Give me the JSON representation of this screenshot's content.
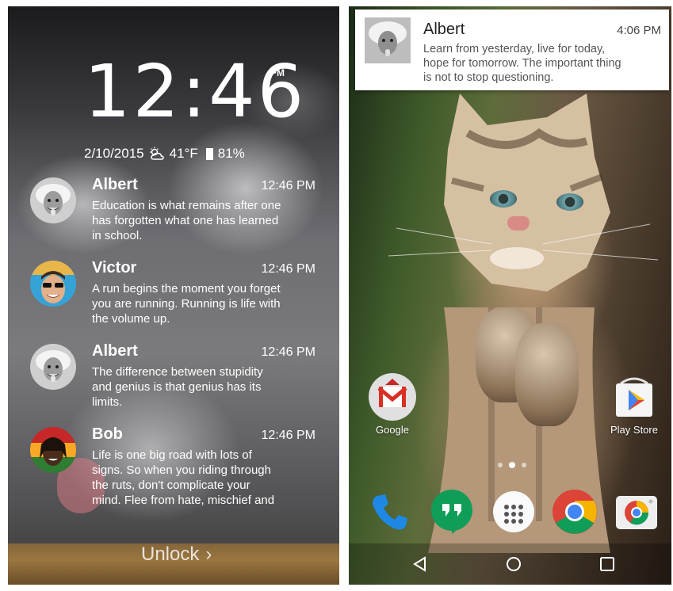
{
  "lock_screen": {
    "clock": "12:46",
    "ampm": "PM",
    "date": "2/10/2015",
    "temperature": "41°F",
    "battery": "81%",
    "notifications": [
      {
        "name": "Albert",
        "time": "12:46 PM",
        "message": "Education is what remains after one has forgotten what one has learned in school."
      },
      {
        "name": "Victor",
        "time": "12:46 PM",
        "message": "A run begins the moment you forget you are running. Running is life with the volume up."
      },
      {
        "name": "Albert",
        "time": "12:46 PM",
        "message": "The difference between stupidity and genius is that genius has its limits."
      },
      {
        "name": "Bob",
        "time": "12:46 PM",
        "message": "Life is one big road with lots of signs. So when you riding through the ruts, don't complicate your mind. Flee from hate, mischief and"
      }
    ],
    "unlock_label": "Unlock",
    "unlock_chevron": "›"
  },
  "home_screen": {
    "heads_up": {
      "name": "Albert",
      "time": "4:06 PM",
      "message": "Learn from yesterday, live for today, hope for tomorrow. The important thing is not to stop questioning."
    },
    "apps": [
      {
        "label": "Google",
        "icon": "gmail-icon"
      },
      {
        "label": "Play Store",
        "icon": "play-store-icon"
      }
    ],
    "dock": [
      "phone-icon",
      "hangouts-icon",
      "app-drawer-icon",
      "chrome-icon",
      "camera-icon"
    ],
    "nav": [
      "back-icon",
      "home-icon",
      "recents-icon"
    ],
    "colors": {
      "gmail_red": "#d93025",
      "hangouts_green": "#0f9d58",
      "phone_blue": "#1e88e5"
    }
  }
}
